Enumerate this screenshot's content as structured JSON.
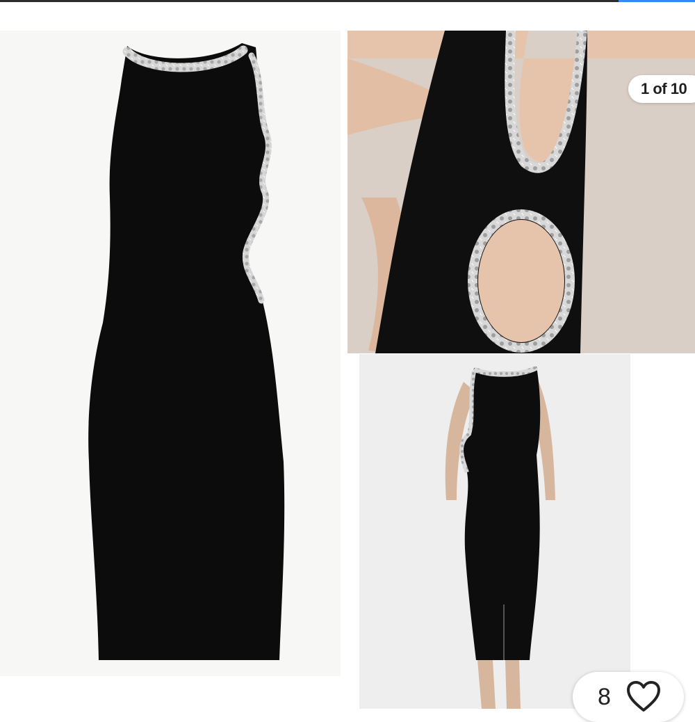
{
  "gallery": {
    "position_label": "1 of 10",
    "images": [
      {
        "name": "front-view",
        "background": "#f7f7f6"
      },
      {
        "name": "side-cutout-closeup",
        "background": "#d9cfc7"
      },
      {
        "name": "back-view",
        "background": "#eeeeee"
      }
    ]
  },
  "like": {
    "count": "8",
    "icon": "heart-outline-icon"
  },
  "colors": {
    "dress": "#0c0c0c",
    "trim": "#d2d2d2",
    "skin": "#e6c3ab",
    "accent": "#3a86ff"
  }
}
